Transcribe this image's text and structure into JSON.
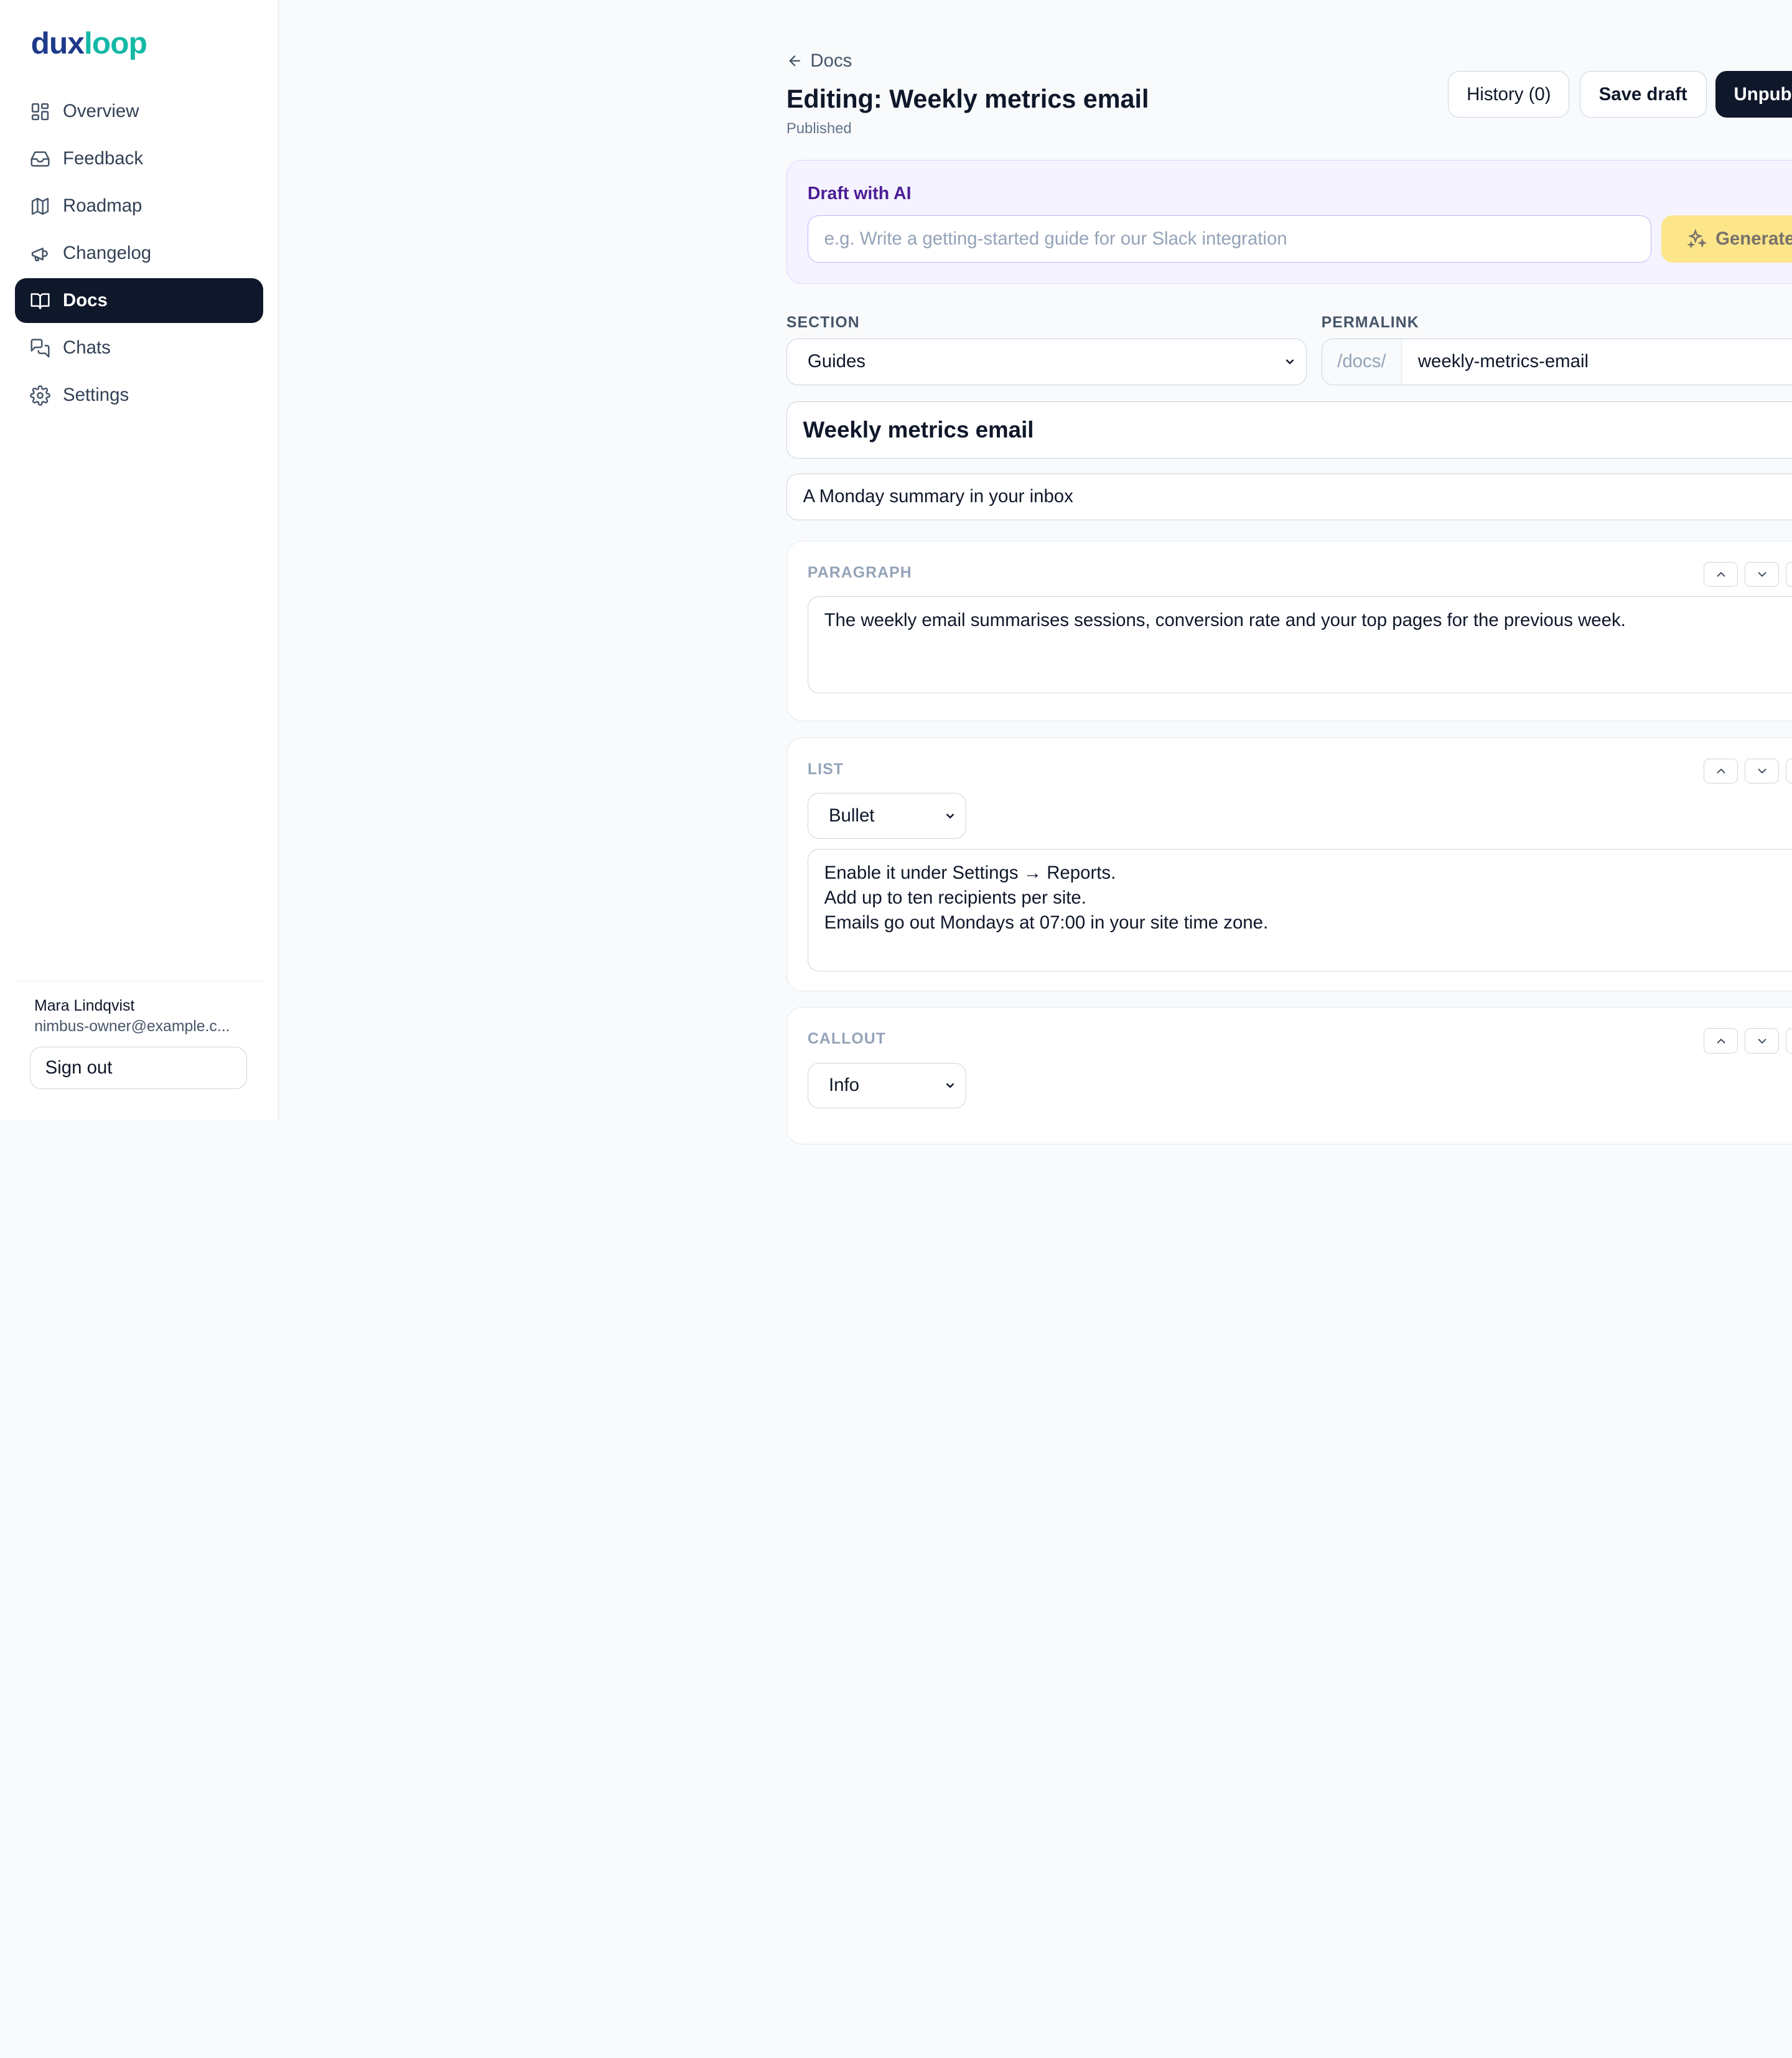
{
  "brand": {
    "part1": "dux",
    "part2": "loop"
  },
  "nav": [
    {
      "label": "Overview",
      "icon": "grid-icon",
      "active": false
    },
    {
      "label": "Feedback",
      "icon": "inbox-icon",
      "active": false
    },
    {
      "label": "Roadmap",
      "icon": "map-icon",
      "active": false
    },
    {
      "label": "Changelog",
      "icon": "megaphone-icon",
      "active": false
    },
    {
      "label": "Docs",
      "icon": "book-icon",
      "active": true
    },
    {
      "label": "Chats",
      "icon": "chat-icon",
      "active": false
    },
    {
      "label": "Settings",
      "icon": "gear-icon",
      "active": false
    }
  ],
  "user": {
    "name": "Mara Lindqvist",
    "email": "nimbus-owner@example.c...",
    "signout": "Sign out"
  },
  "header": {
    "back": "Docs",
    "title": "Editing: Weekly metrics email",
    "status": "Published",
    "history": "History (0)",
    "save": "Save draft",
    "unpublish": "Unpublish"
  },
  "ai": {
    "label": "Draft with AI",
    "placeholder": "e.g. Write a getting-started guide for our Slack integration",
    "generate": "Generate"
  },
  "form": {
    "section_label": "SECTION",
    "section_value": "Guides",
    "permalink_label": "PERMALINK",
    "permalink_prefix": "/docs/",
    "permalink_value": "weekly-metrics-email",
    "title_value": "Weekly metrics email",
    "subtitle_value": "A Monday summary in your inbox"
  },
  "blocks": [
    {
      "type": "PARAGRAPH",
      "text": "The weekly email summarises sessions, conversion rate and your top pages for the previous week."
    },
    {
      "type": "LIST",
      "style": "Bullet",
      "items": [
        "Enable it under Settings → Reports.",
        "Add up to ten recipients per site.",
        "Emails go out Mondays at 07:00 in your site time zone."
      ]
    },
    {
      "type": "CALLOUT",
      "style": "Info"
    }
  ],
  "colors": {
    "primary": "#0f172a",
    "brand_dark": "#1e3a8a",
    "brand_teal": "#14b8a6",
    "ai_bg": "#f5f3ff",
    "generate_bg": "#fde68a",
    "delete": "#dc2626"
  }
}
